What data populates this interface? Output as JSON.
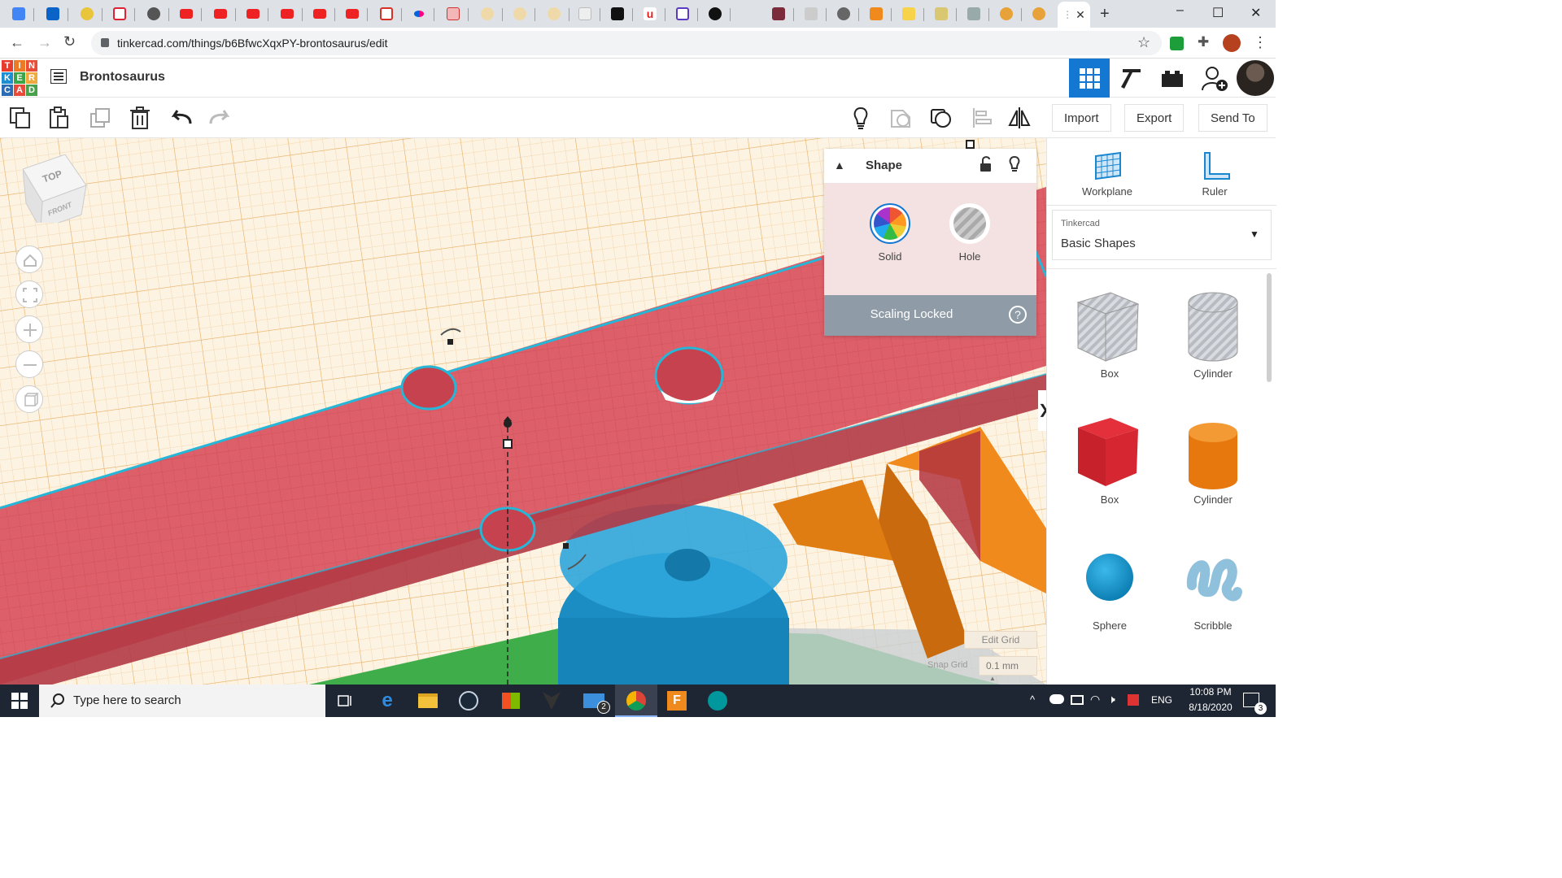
{
  "browser": {
    "url": "tinkercad.com/things/b6BfwcXqxPY-brontosaurus/edit",
    "tab_favicons": [
      "google-doc",
      "outlook",
      "g-hub",
      "gmail-m",
      "globe",
      "youtube",
      "youtube",
      "youtube",
      "youtube",
      "youtube",
      "youtube",
      "gmail",
      "flickr",
      "pdf",
      "bulb",
      "bulb",
      "bulb",
      "notion",
      "star",
      "u-app",
      "s-app",
      "dark-logo",
      "grid-app",
      "pen",
      "globe",
      "waffle",
      "folder",
      "badge",
      "wave",
      "avatar",
      "avatar"
    ],
    "active_tab_close": "✕",
    "new_tab": "+",
    "window_controls": {
      "minimize": "–",
      "maximize": "☐",
      "close": "✕"
    }
  },
  "header": {
    "logo_letters": [
      "T",
      "I",
      "N",
      "K",
      "E",
      "R",
      "C",
      "A",
      "D"
    ],
    "logo_colors": [
      "#e83d2c",
      "#ee7b24",
      "#ea4d35",
      "#1a8ed1",
      "#3aa648",
      "#f2a93b",
      "#2b6cb5",
      "#e84a3b",
      "#48a24c"
    ],
    "title": "Brontosaurus"
  },
  "toolbar": {
    "import_label": "Import",
    "export_label": "Export",
    "send_to_label": "Send To"
  },
  "viewcube": {
    "top": "TOP",
    "front": "FRONT"
  },
  "shape_panel": {
    "title": "Shape",
    "solid_label": "Solid",
    "hole_label": "Hole",
    "scaling_label": "Scaling Locked",
    "help": "?"
  },
  "grid": {
    "edit_grid_label": "Edit Grid",
    "snap_grid_label": "Snap Grid",
    "snap_value": "0.1 mm"
  },
  "right_panel": {
    "workplane_label": "Workplane",
    "ruler_label": "Ruler",
    "library_source": "Tinkercad",
    "library_name": "Basic Shapes",
    "shapes": [
      {
        "label": "Box",
        "kind": "hole-box"
      },
      {
        "label": "Cylinder",
        "kind": "hole-cylinder"
      },
      {
        "label": "Box",
        "kind": "box"
      },
      {
        "label": "Cylinder",
        "kind": "cylinder"
      },
      {
        "label": "Sphere",
        "kind": "sphere"
      },
      {
        "label": "Scribble",
        "kind": "scribble"
      }
    ]
  },
  "taskbar": {
    "search_placeholder": "Type here to search",
    "mail_badge": "2",
    "language": "ENG",
    "time": "10:08 PM",
    "date": "8/18/2020",
    "notification_count": "3"
  },
  "colors": {
    "accent": "#1477d2",
    "workspace_red": "#d9535e",
    "selection_cyan": "#25b6d8",
    "taskbar": "#1f2633"
  }
}
